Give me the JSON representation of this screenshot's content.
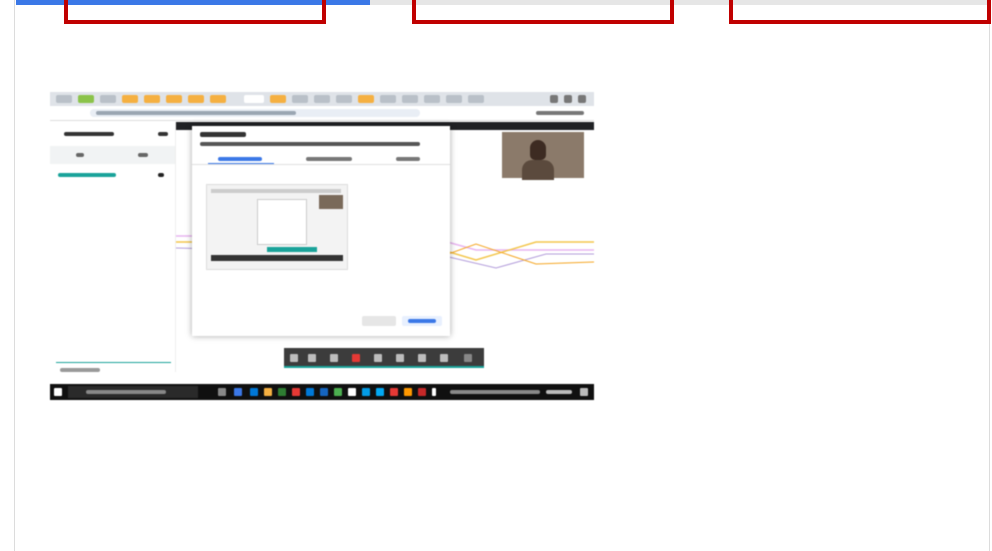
{
  "tabs": [
    {
      "name": "tab-1",
      "active": true
    },
    {
      "name": "tab-2",
      "active": false
    },
    {
      "name": "tab-3",
      "active": false
    }
  ],
  "highlight_color": "#c00000",
  "accent_color": "#3b78e7",
  "screenshot": {
    "presenter_label": "",
    "sidebar_link": "",
    "dialog_title": "",
    "cancel_label": "",
    "share_label": "",
    "search_placeholder": "",
    "taskbar_time": ""
  }
}
